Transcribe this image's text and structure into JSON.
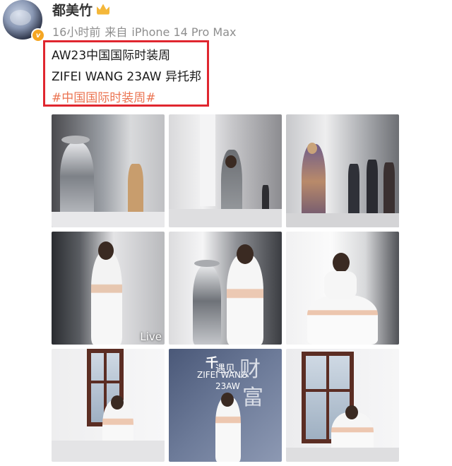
{
  "post": {
    "username": "都美竹",
    "time": "16小时前",
    "source_prefix": "来自",
    "device": "iPhone 14 Pro Max",
    "verified_mark": "v",
    "lines": [
      "AW23中国国际时装周",
      "ZIFEI WANG 23AW 异托邦",
      "#中国国际时装周#"
    ]
  },
  "photos": [
    {
      "scene": "silver-installation-and-mannequin"
    },
    {
      "scene": "model-in-grey-on-runway"
    },
    {
      "scene": "model-in-patterned-dress-on-runway"
    },
    {
      "scene": "woman-in-white-crop-top",
      "badge": "Live"
    },
    {
      "scene": "woman-in-white-with-silver-sculpture"
    },
    {
      "scene": "woman-in-white-seated"
    },
    {
      "scene": "woman-in-white-by-window"
    },
    {
      "scene": "woman-at-backdrop",
      "overlay": [
        "ZIFEI WANG",
        "23AW",
        "遇见",
        "财",
        "富"
      ]
    },
    {
      "scene": "woman-seated-by-window"
    }
  ],
  "colors": {
    "highlight_box": "#e0262f",
    "topic_link": "#eb7350",
    "meta_gray": "#8e8e8e",
    "verified_badge": "#f5a623"
  },
  "icons": [
    "avatar",
    "verified-badge-icon",
    "vip-crown-icon"
  ]
}
